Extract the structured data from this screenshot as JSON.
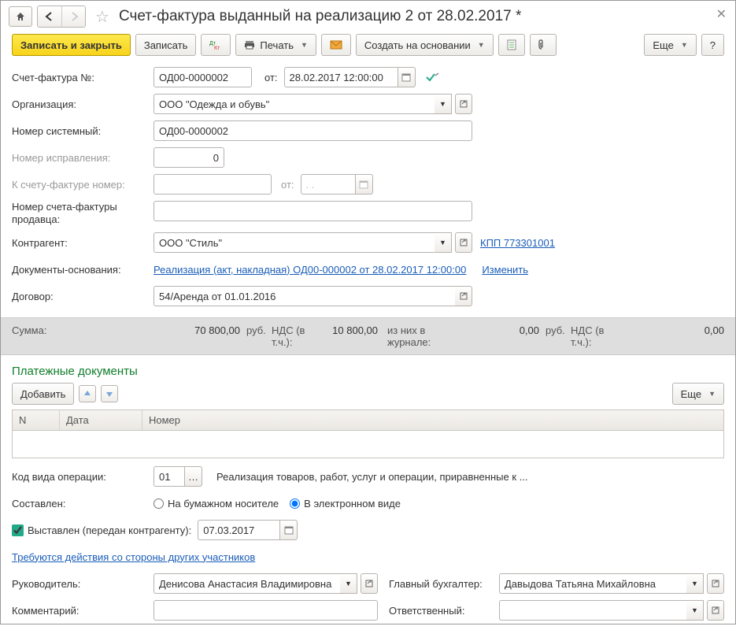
{
  "title": "Счет-фактура выданный на реализацию 2 от 28.02.2017 *",
  "toolbar": {
    "save_close": "Записать и закрыть",
    "save": "Записать",
    "print": "Печать",
    "create_on_basis": "Создать на основании",
    "more": "Еще"
  },
  "labels": {
    "invoice_no": "Счет-фактура №:",
    "from": "от:",
    "org": "Организация:",
    "sys_no": "Номер системный:",
    "correction_no": "Номер исправления:",
    "to_invoice_no": "К счету-фактуре номер:",
    "to_from": "от:",
    "seller_invoice_no": "Номер счета-фактуры продавца:",
    "counterparty": "Контрагент:",
    "basis_docs": "Документы-основания:",
    "contract": "Договор:",
    "sum": "Сумма:",
    "rub": "руб.",
    "vat_incl": "НДС (в т.ч.):",
    "journal_of": "из них в журнале:",
    "vat_incl2": "НДС (в т.ч.):",
    "payment_docs": "Платежные документы",
    "add": "Добавить",
    "col_n": "N",
    "col_date": "Дата",
    "col_no": "Номер",
    "op_code": "Код вида операции:",
    "op_desc": "Реализация товаров, работ, услуг и операции, приравненные к ...",
    "composed": "Составлен:",
    "paper": "На бумажном носителе",
    "electronic": "В электронном виде",
    "issued": "Выставлен (передан контрагенту):",
    "actions_link": "Требуются действия со стороны других участников",
    "manager": "Руководитель:",
    "chief_acc": "Главный бухгалтер:",
    "comment": "Комментарий:",
    "responsible": "Ответственный:",
    "change": "Изменить"
  },
  "values": {
    "invoice_no": "ОД00-0000002",
    "date": "28.02.2017 12:00:00",
    "org": "ООО \"Одежда и обувь\"",
    "sys_no": "ОД00-0000002",
    "correction_no": "0",
    "to_invoice_no": "",
    "to_date": ". .",
    "seller_invoice_no": "",
    "counterparty": "ООО \"Стиль\"",
    "kpp_link": "КПП 773301001",
    "basis_doc": "Реализация (акт, накладная) ОД00-000002 от 28.02.2017 12:00:00",
    "contract": "54/Аренда от 01.01.2016",
    "sum": "70 800,00",
    "vat": "10 800,00",
    "journal": "0,00",
    "vat2": "0,00",
    "op_code": "01",
    "issued_date": "07.03.2017",
    "manager": "Денисова Анастасия Владимировна",
    "chief_acc": "Давыдова Татьяна Михайловна",
    "comment": "",
    "responsible": ""
  }
}
